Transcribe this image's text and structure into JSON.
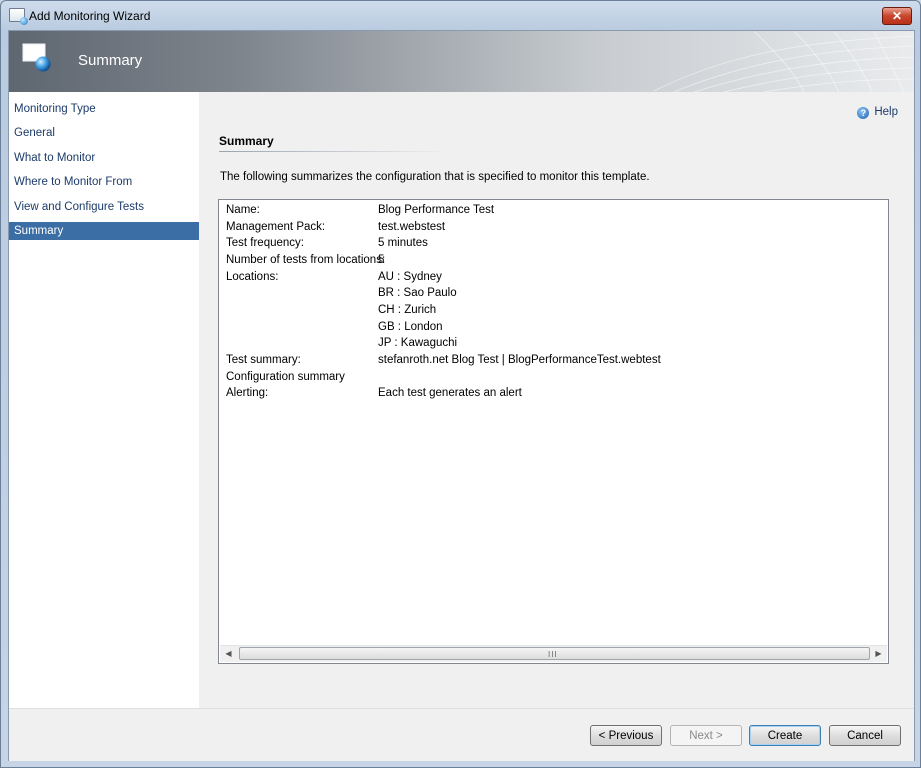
{
  "window": {
    "title": "Add Monitoring Wizard",
    "close_glyph": "✕"
  },
  "banner": {
    "title": "Summary",
    "icon": "monitor-globe-icon"
  },
  "nav": {
    "items": [
      {
        "label": "Monitoring Type",
        "selected": false
      },
      {
        "label": "General",
        "selected": false
      },
      {
        "label": "What to Monitor",
        "selected": false
      },
      {
        "label": "Where to Monitor From",
        "selected": false
      },
      {
        "label": "View and Configure Tests",
        "selected": false
      },
      {
        "label": "Summary",
        "selected": true
      }
    ]
  },
  "help": {
    "label": "Help",
    "glyph": "?"
  },
  "section": {
    "title": "Summary",
    "intro": "The following summarizes the configuration that is specified to monitor this template."
  },
  "summary": {
    "rows": [
      {
        "key": "Name:",
        "value": "Blog Performance Test"
      },
      {
        "key": "Management Pack:",
        "value": "test.webstest"
      },
      {
        "key": "Test frequency:",
        "value": "5 minutes"
      },
      {
        "key": "Number of tests from locations:",
        "value": "5"
      },
      {
        "key": "Locations:",
        "value": "AU : Sydney"
      },
      {
        "key": "",
        "value": "BR : Sao Paulo"
      },
      {
        "key": "",
        "value": "CH : Zurich"
      },
      {
        "key": "",
        "value": "GB : London"
      },
      {
        "key": "",
        "value": "JP : Kawaguchi"
      },
      {
        "key": "Test summary:",
        "value": "stefanroth.net Blog Test | BlogPerformanceTest.webtest"
      },
      {
        "key": "Configuration summary",
        "value": ""
      },
      {
        "key": "Alerting:",
        "value": "Each test generates an alert"
      }
    ]
  },
  "scrollbar": {
    "left_glyph": "◀",
    "right_glyph": "▶",
    "grip_glyph": "III"
  },
  "buttons": {
    "previous": "< Previous",
    "next": "Next >",
    "create": "Create",
    "cancel": "Cancel"
  },
  "colors": {
    "selection": "#3b6ea5",
    "nav_text": "#1c3b6a",
    "close": "#c9452b"
  }
}
